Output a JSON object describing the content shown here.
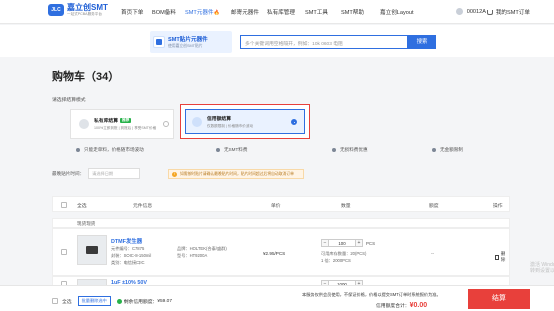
{
  "nav": {
    "logo_mark": "JLC",
    "logo_title": "嘉立创SMT",
    "logo_sub": "一站式PCBA服务平台",
    "items": [
      "首页下单",
      "BOM备料",
      "SMT元器件",
      "邮寄元器件",
      "私有库管理",
      "SMT工具",
      "SMT帮助",
      "嘉立创Layout"
    ],
    "hot_mark": "🔥",
    "user": "00012A",
    "cart_link": "我的SMT订单"
  },
  "banner": {
    "title": "SMT贴片元器件",
    "subtitle": "使用嘉立创SMT贴片"
  },
  "search": {
    "placeholder": "多个关键词用空格隔开，例如：10k 0603 电阻",
    "button": "搜索"
  },
  "page_title": "购物车（34）",
  "payment": {
    "label": "请选择结算模式",
    "options": [
      {
        "name": "私有库结算",
        "tag": "推荐",
        "desc": "100%立即到账 | 到账后 | 享受SMT价格",
        "selected": false
      },
      {
        "name": "信用额结算",
        "tag": "",
        "desc": "仅数额限制 | 价格随市价波动",
        "selected": true
      }
    ]
  },
  "features": [
    "只能走单料，价格随市场波动",
    "无SMT料费",
    "无损料费优惠",
    "无金额限制"
  ],
  "date_row": {
    "label": "最晚贴片时间：",
    "placeholder": "请选择日期"
  },
  "notice": {
    "icon": "!",
    "text": "如需按时贴片请确认最晚贴片时间，贴片时间超过后将自动取消订单"
  },
  "table": {
    "headers": [
      "全选",
      "元件信息",
      "单价",
      "数量",
      "额度",
      "操作"
    ],
    "group_label": "现货现货"
  },
  "items": [
    {
      "name": "DTMF发生器",
      "code_line": "元件编号：C7875",
      "package_line": "封装：SOIC-8-150mil",
      "type_line": "类别：电信接口IC",
      "brand_line": "品牌：HOLTEK(合泰/盛群)",
      "model_line": "型号：HT9200A",
      "price": "¥2.95/PCS",
      "qty": "100",
      "unit": "PCS",
      "qty_note1": "可用库存数量：20(PCS)",
      "qty_note2": "1 倍：2000PCS",
      "discount": "--",
      "delete": "删除"
    },
    {
      "name": "1uF ±10% 50V",
      "qty": "1000"
    }
  ],
  "footer": {
    "select_all": "全选",
    "delete_link": "批量删除选中",
    "credit_label": "剩余信用额度：",
    "credit_value": "¥59.07",
    "note": "本服务仅供会员使用，不保证价格，价格以提交SMT订单时系统报价为准。",
    "total_label": "信用额度合计：",
    "total_value": "¥0.00",
    "settle": "结算"
  },
  "watermark": "激活 Windows\n转到设置以激活"
}
